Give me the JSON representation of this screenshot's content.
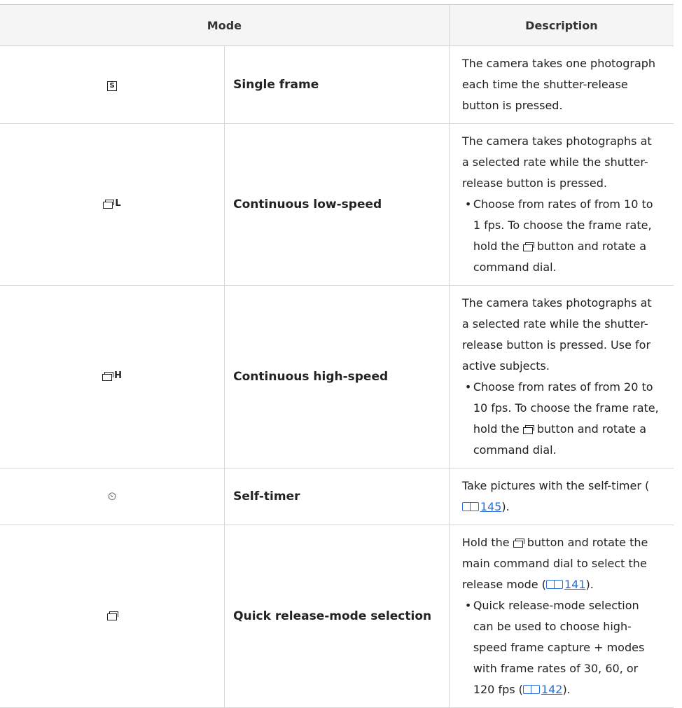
{
  "header": {
    "mode": "Mode",
    "description": "Description"
  },
  "rows": [
    {
      "icon_name": "single-frame-icon",
      "icon_glyph": "S",
      "name": "Single frame",
      "description": "The camera takes one photograph each time the shutter-release button is pressed.",
      "bullet": ""
    },
    {
      "icon_name": "continuous-low-speed-icon",
      "icon_suffix": "L",
      "name": "Continuous low-speed",
      "description": "The camera takes photographs at a selected rate while the shutter-release button is pressed.",
      "bullet_before": "Choose from rates of from 10 to 1 fps. To choose the frame rate, hold the ",
      "bullet_after": " button and rotate a command dial."
    },
    {
      "icon_name": "continuous-high-speed-icon",
      "icon_suffix": "H",
      "name": "Continuous high-speed",
      "description": "The camera takes photographs at a selected rate while the shutter-release button is pressed. Use for active subjects.",
      "bullet_before": "Choose from rates of from 20 to 10 fps. To choose the frame rate, hold the ",
      "bullet_after": " button and rotate a command dial."
    },
    {
      "icon_name": "self-timer-icon",
      "icon_glyph": "⏲",
      "name": "Self-timer",
      "description_before": "Take pictures with the self-timer (",
      "ref": "145",
      "description_after": ")."
    },
    {
      "icon_name": "quick-release-mode-icon",
      "name": "Quick release-mode selection",
      "description_before": "Hold the ",
      "description_mid": " button and rotate the main command dial to select the release mode (",
      "ref": "141",
      "description_after": ").",
      "bullet_before": "Quick release-mode selection can be used to choose high-speed frame capture + modes with frame rates of 30, 60, or 120 fps (",
      "bullet_ref": "142",
      "bullet_after": ")."
    }
  ]
}
